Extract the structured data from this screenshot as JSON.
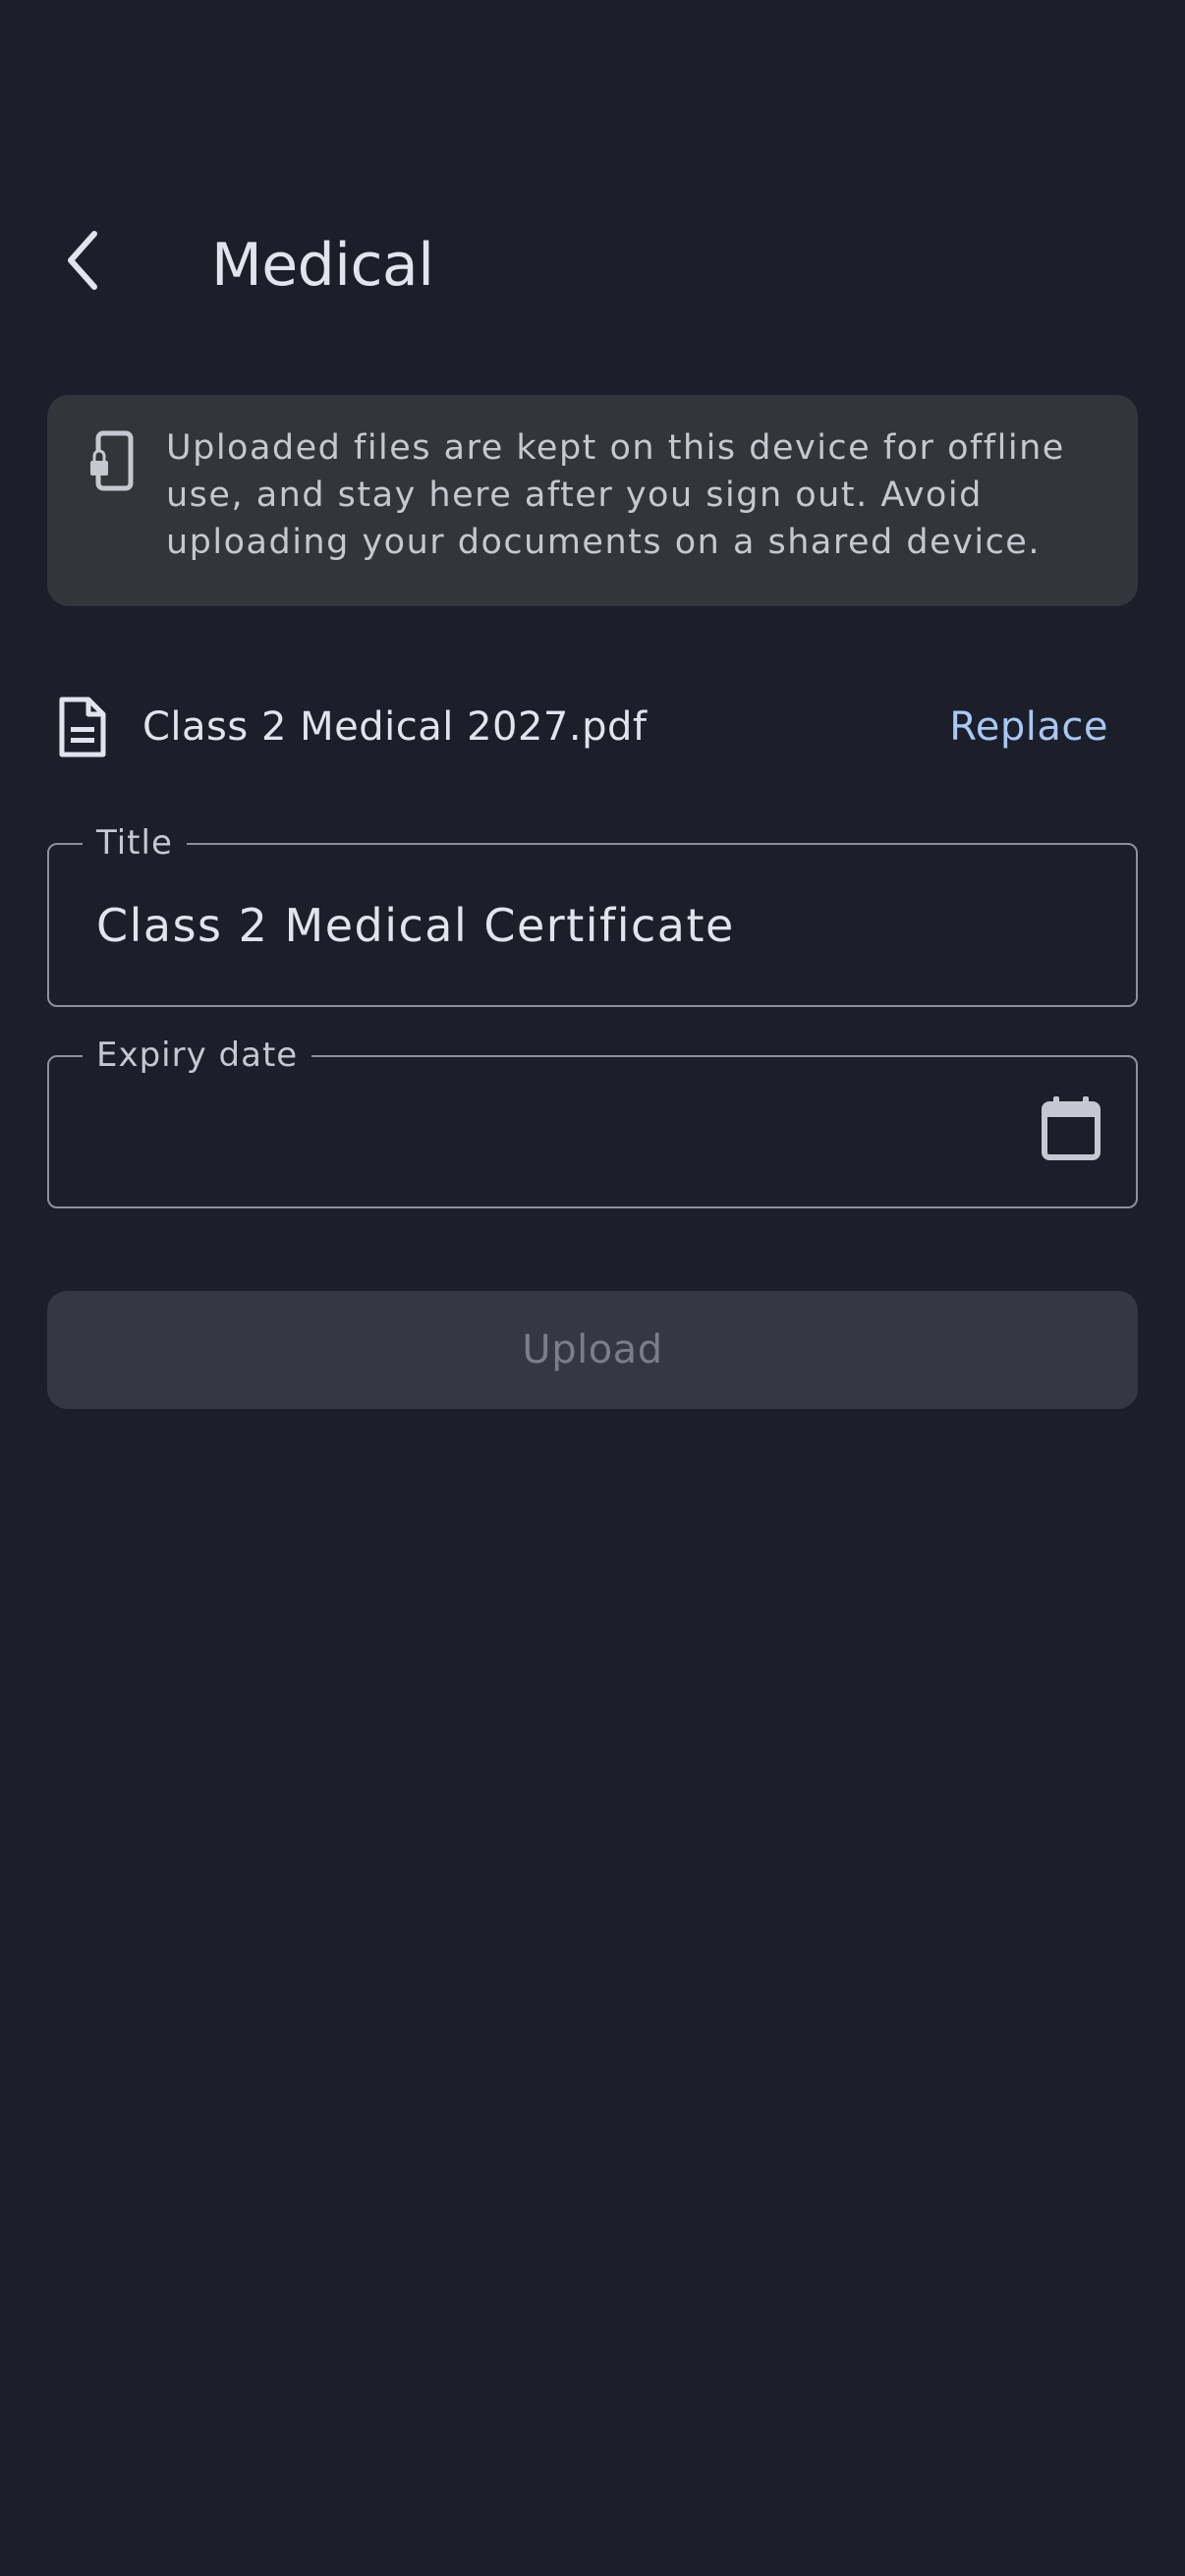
{
  "header": {
    "back_icon": "chevron-left-icon",
    "title": "Medical"
  },
  "notice": {
    "icon": "phone-lock-icon",
    "text": "Uploaded files are kept on this device for offline use, and stay here after you sign out. Avoid uploading your documents on a shared device."
  },
  "file": {
    "icon": "document-icon",
    "name": "Class 2 Medical 2027.pdf",
    "replace_label": "Replace"
  },
  "form": {
    "title_label": "Title",
    "title_value": "Class 2 Medical Certificate",
    "expiry_label": "Expiry date",
    "expiry_value": "",
    "calendar_icon": "calendar-icon"
  },
  "upload": {
    "label": "Upload",
    "enabled": false
  },
  "colors": {
    "background": "#1c1f29",
    "card": "#34353b",
    "accent": "#a8c8f5",
    "outline": "#8e909a",
    "disabled_button": "#353844",
    "disabled_text": "#7b7e88"
  }
}
